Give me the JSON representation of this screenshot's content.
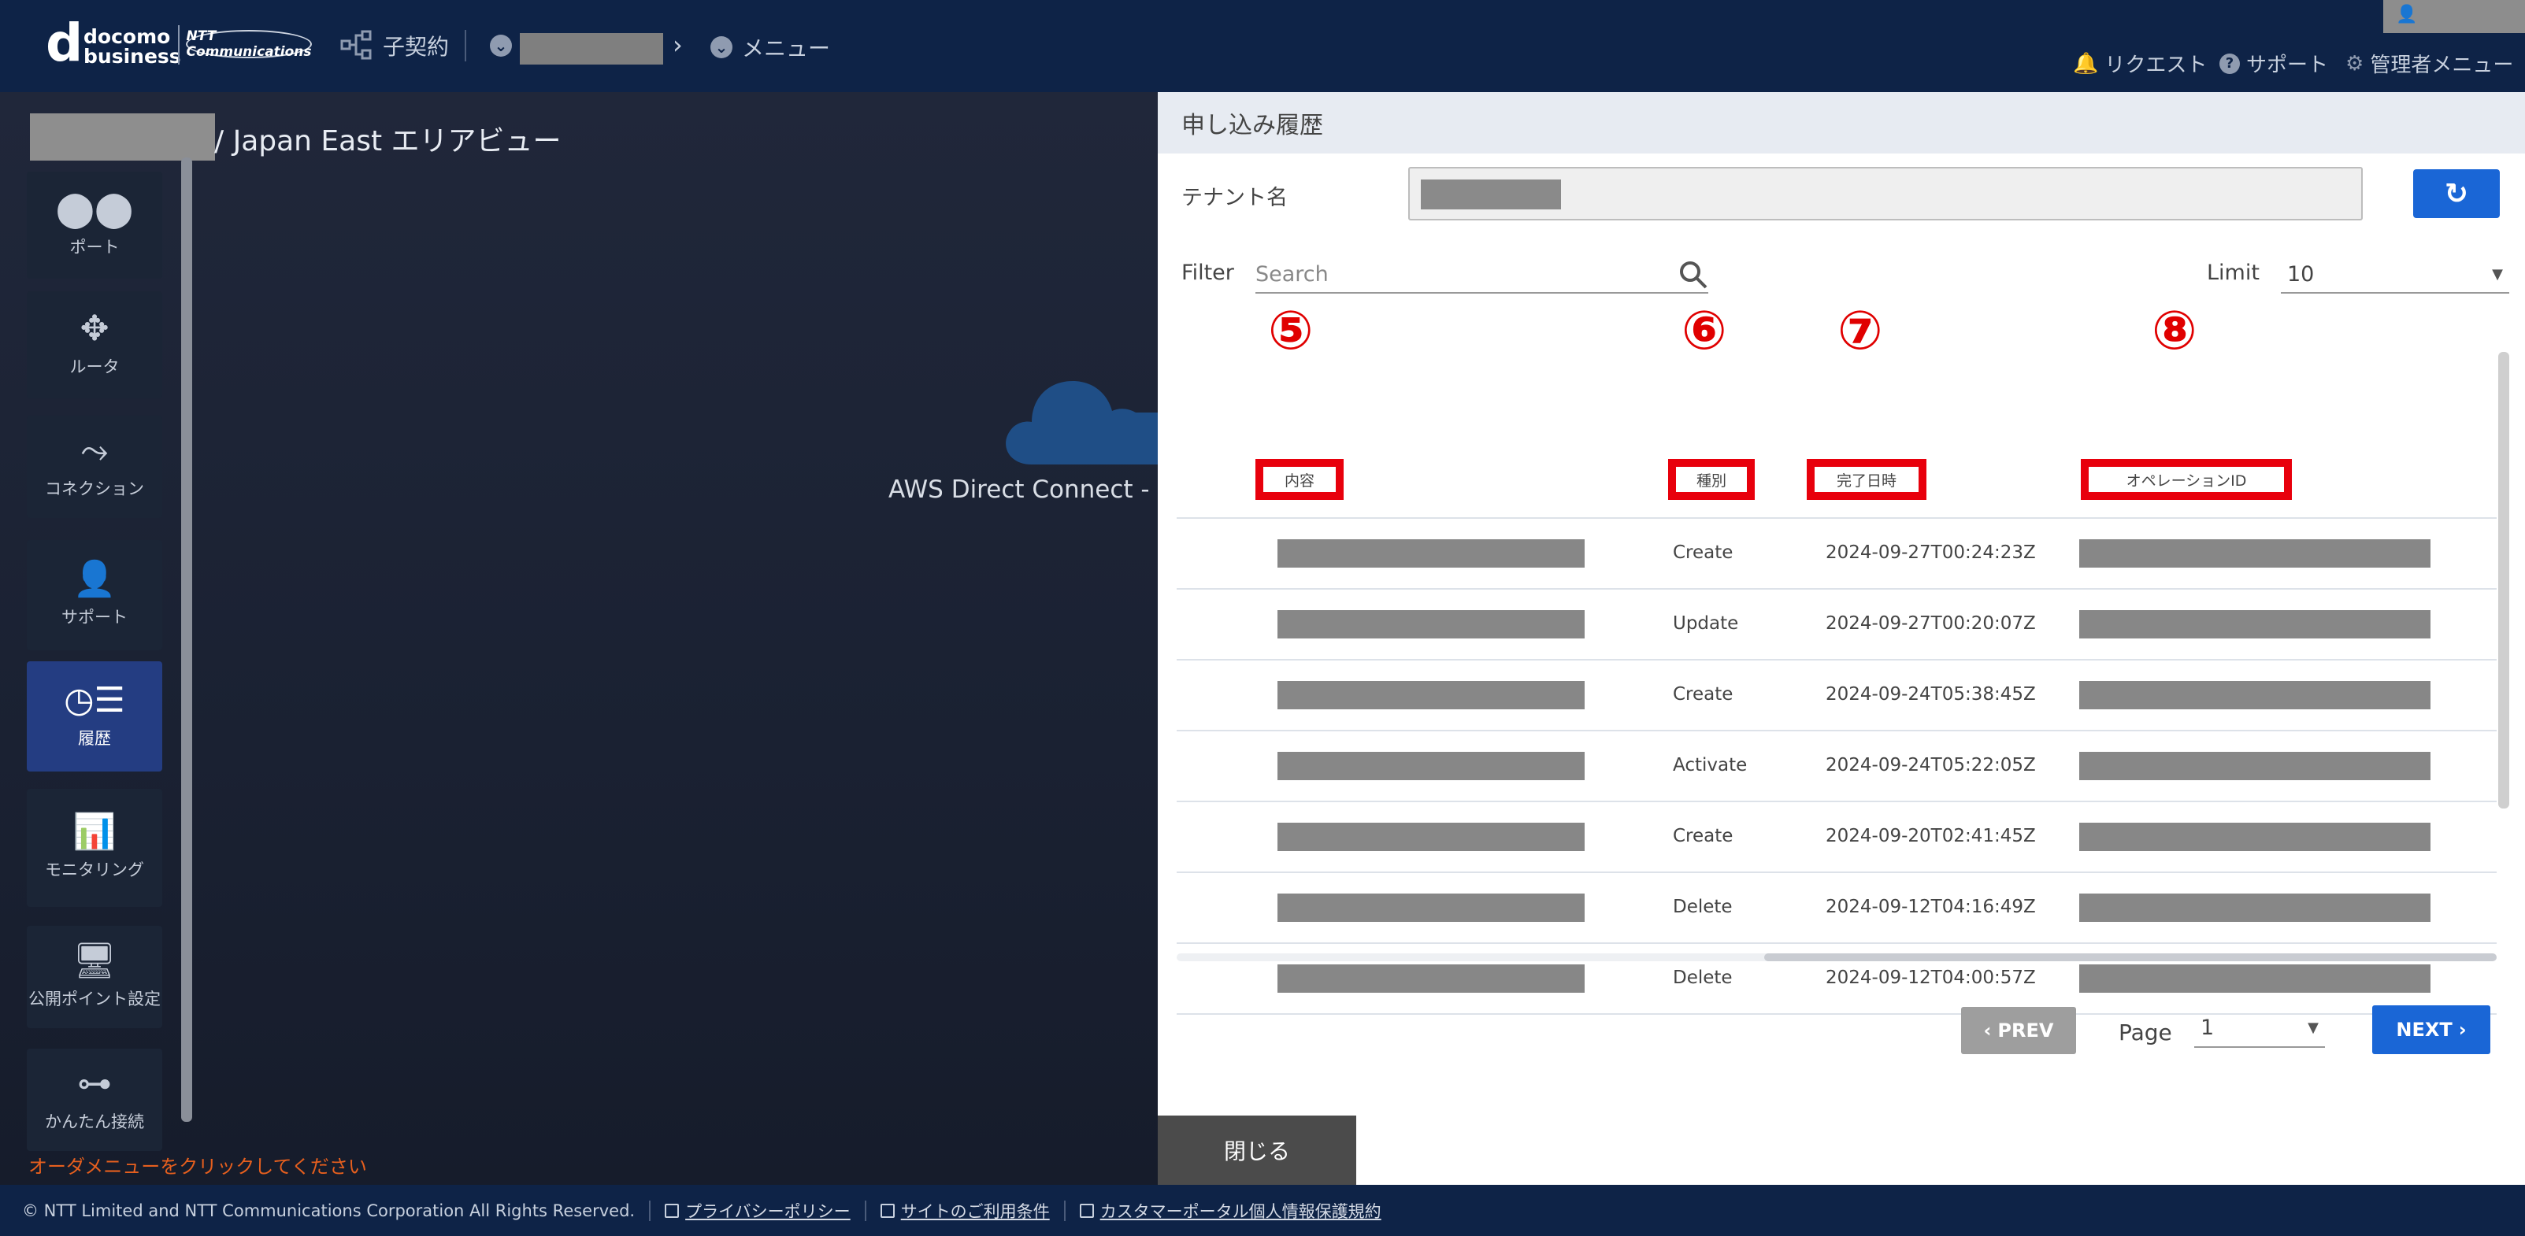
{
  "header": {
    "logo_letter": "d",
    "logo_text_line1": "docomo",
    "logo_text_line2": "business",
    "ntt_badge": "NTT Communications",
    "contract_label": "子契約",
    "menu_label": "メニュー",
    "request_label": "リクエスト",
    "support_label": "サポート",
    "admin_label": "管理者メニュー"
  },
  "main": {
    "area_title": "/ Japan East エリアビュー",
    "aws_label": "AWS Direct Connect - P",
    "order_hint": "オーダメニューをクリックしてください"
  },
  "sidebar": {
    "items": [
      {
        "label": "ポート",
        "icon": "port-icon",
        "glyph": "⬤⬤",
        "active": false
      },
      {
        "label": "ルータ",
        "icon": "router-icon",
        "glyph": "✥",
        "active": false
      },
      {
        "label": "コネクション",
        "icon": "connection-icon",
        "glyph": "⤳",
        "active": false
      },
      {
        "label": "サポート",
        "icon": "support-user-icon",
        "glyph": "👤",
        "active": false
      },
      {
        "label": "履歴",
        "icon": "history-icon",
        "glyph": "◷☰",
        "active": true
      },
      {
        "label": "モニタリング",
        "icon": "monitoring-icon",
        "glyph": "📊",
        "active": false
      },
      {
        "label": "公開ポイント設定",
        "icon": "public-point-icon",
        "glyph": "🖥",
        "active": false
      },
      {
        "label": "かんたん接続",
        "icon": "easy-connect-icon",
        "glyph": "⊶",
        "active": false
      }
    ]
  },
  "panel": {
    "title": "申し込み履歴",
    "tenant_label": "テナント名",
    "filter_label": "Filter",
    "search_placeholder": "Search",
    "limit_label": "Limit",
    "limit_value": "10",
    "annotations": [
      "⑤",
      "⑥",
      "⑦",
      "⑧"
    ],
    "columns": [
      "内容",
      "種別",
      "完了日時",
      "オペレーションID"
    ],
    "rows": [
      {
        "type": "Create",
        "completed": "2024-09-27T00:24:23Z"
      },
      {
        "type": "Update",
        "completed": "2024-09-27T00:20:07Z"
      },
      {
        "type": "Create",
        "completed": "2024-09-24T05:38:45Z"
      },
      {
        "type": "Activate",
        "completed": "2024-09-24T05:22:05Z"
      },
      {
        "type": "Create",
        "completed": "2024-09-20T02:41:45Z"
      },
      {
        "type": "Delete",
        "completed": "2024-09-12T04:16:49Z"
      },
      {
        "type": "Delete",
        "completed": "2024-09-12T04:00:57Z"
      }
    ],
    "prev_label": "PREV",
    "next_label": "NEXT",
    "page_label": "Page",
    "page_value": "1",
    "close_label": "閉じる"
  },
  "footer": {
    "copyright": "© NTT Limited and NTT Communications Corporation All Rights Reserved.",
    "links": [
      "プライバシーポリシー",
      "サイトのご利用条件",
      "カスタマーポータル個人情報保護規約"
    ]
  },
  "colors": {
    "header_bg": "#0e2347",
    "accent_blue": "#1a66d6",
    "annotation_red": "#e8000c",
    "hint_orange": "#e65f1e"
  }
}
